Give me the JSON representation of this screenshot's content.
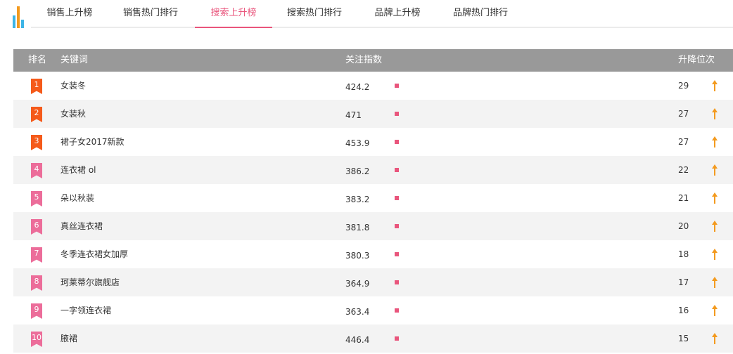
{
  "tabs": [
    {
      "label": "销售上升榜",
      "active": false
    },
    {
      "label": "销售热门排行",
      "active": false
    },
    {
      "label": "搜索上升榜",
      "active": true
    },
    {
      "label": "搜索热门排行",
      "active": false
    },
    {
      "label": "品牌上升榜",
      "active": false
    },
    {
      "label": "品牌热门排行",
      "active": false
    }
  ],
  "table": {
    "headers": {
      "rank": "排名",
      "keyword": "关键词",
      "index": "关注指数",
      "change": "升降位次"
    },
    "rows": [
      {
        "rank": "1",
        "keyword": "女装冬",
        "index": "424.2",
        "change": "29"
      },
      {
        "rank": "2",
        "keyword": "女装秋",
        "index": "471",
        "change": "27"
      },
      {
        "rank": "3",
        "keyword": "裙子女2017新款",
        "index": "453.9",
        "change": "27"
      },
      {
        "rank": "4",
        "keyword": "连衣裙 ol",
        "index": "386.2",
        "change": "22"
      },
      {
        "rank": "5",
        "keyword": "朵以秋装",
        "index": "383.2",
        "change": "21"
      },
      {
        "rank": "6",
        "keyword": "真丝连衣裙",
        "index": "381.8",
        "change": "20"
      },
      {
        "rank": "7",
        "keyword": "冬季连衣裙女加厚",
        "index": "380.3",
        "change": "18"
      },
      {
        "rank": "8",
        "keyword": "珂莱蒂尔旗舰店",
        "index": "364.9",
        "change": "17"
      },
      {
        "rank": "9",
        "keyword": "一字领连衣裙",
        "index": "363.4",
        "change": "16"
      },
      {
        "rank": "10",
        "keyword": "腋裙",
        "index": "446.4",
        "change": "15"
      }
    ]
  },
  "colors": {
    "accent": "#e9557c",
    "top3_badge": "#f55a1a",
    "badge": "#ec6d9a",
    "arrow": "#f39a1e",
    "header_bg": "#999999"
  },
  "icons": {
    "logo": "bar-chart-logo-icon",
    "trend": "up-arrow-icon"
  }
}
